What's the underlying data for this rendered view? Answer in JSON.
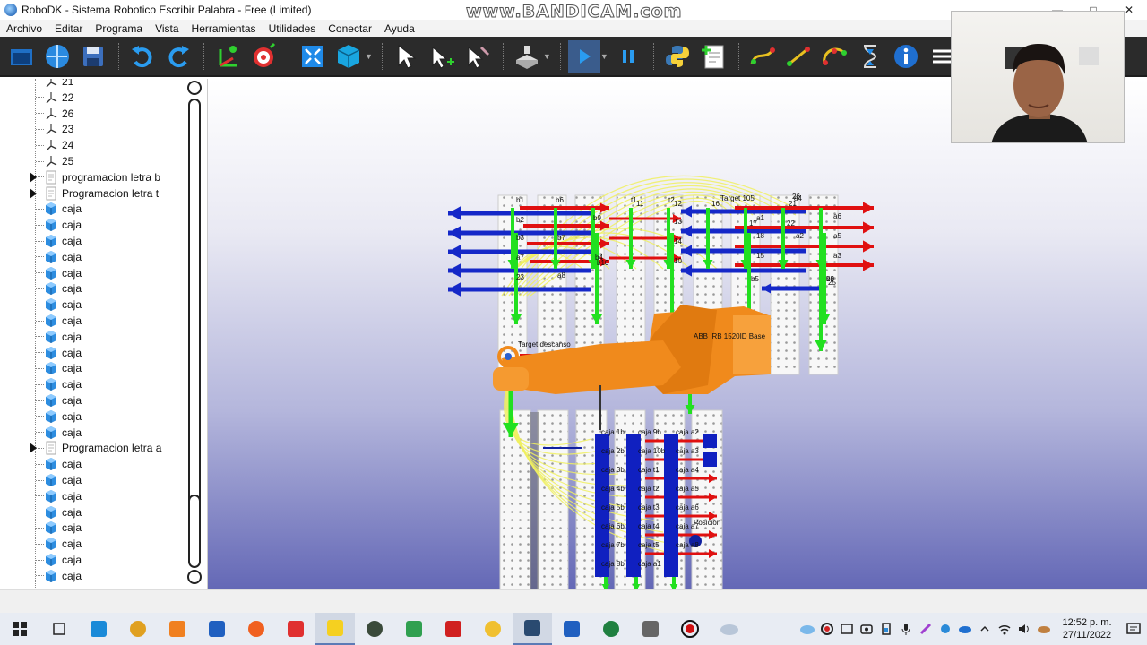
{
  "window": {
    "title": "RoboDK - Sistema Robotico Escribir Palabra - Free (Limited)",
    "watermark": "www.BANDICAM.com"
  },
  "menu": [
    "Archivo",
    "Editar",
    "Programa",
    "Vista",
    "Herramientas",
    "Utilidades",
    "Conectar",
    "Ayuda"
  ],
  "toolbar": {
    "icons": [
      "open-station-icon",
      "online-library-icon",
      "save-icon",
      "undo-icon",
      "redo-icon",
      "add-reference-frame-icon",
      "add-target-icon",
      "fit-all-icon",
      "iso-view-icon",
      "select-icon",
      "move-reference-icon",
      "move-tool-icon",
      "collision-icon",
      "run-program-icon",
      "pause-icon",
      "python-icon",
      "add-program-icon",
      "move-joint-icon",
      "move-linear-icon",
      "move-circular-icon",
      "pause-instruction-icon",
      "info-icon",
      "more-icon"
    ]
  },
  "tree": {
    "targets": [
      "21",
      "22",
      "26",
      "23",
      "24",
      "25"
    ],
    "programs_top": [
      "programacion letra b",
      "Programacion letra t"
    ],
    "caja_label": "caja",
    "caja_count_first": 15,
    "program_mid": "Programacion letra a",
    "caja_count_second": 8
  },
  "scene": {
    "top_targets": [
      "b1",
      "b6",
      "t1",
      "t2",
      "Target 105",
      "a4",
      "b2",
      "b9",
      "11",
      "12",
      "16",
      "21",
      "a6",
      "13",
      "a1",
      "17",
      "22",
      "b3",
      "b7",
      "14",
      "18",
      "a2",
      "a5",
      "a7",
      "b4",
      "b10",
      "10",
      "15",
      "a3",
      "23",
      "a8",
      "b5",
      "b8",
      "20",
      "25",
      "26"
    ],
    "robot_label": "ABB IRB 1520ID Base",
    "home_label": "Target descanso",
    "box_labels_col1": [
      "caja 1b",
      "caja 2b",
      "caja 3b",
      "caja 4b",
      "caja 5b",
      "caja 6b",
      "caja 7b",
      "caja 8b"
    ],
    "box_labels_col2": [
      "caja 9b",
      "caja 10b",
      "caja t1",
      "caja t2",
      "caja t3",
      "caja t4",
      "caja t5",
      "caja a1"
    ],
    "box_labels_col3": [
      "caja a2",
      "caja a3",
      "caja a4",
      "caja a5",
      "caja a6",
      "caja a7",
      "caja a8"
    ],
    "posicion_label": "Posición"
  },
  "taskbar": {
    "apps": [
      "windows-start-icon",
      "task-view-icon",
      "edge-icon",
      "chrome-icon",
      "sublime-icon",
      "remote-desktop-icon",
      "firefox-icon",
      "anydesk-icon",
      "sticky-notes-icon",
      "mathworks-icon",
      "network-tool-icon",
      "acrobat-icon",
      "file-explorer-icon",
      "robodk-icon",
      "word-icon",
      "excel-icon",
      "vmware-icon",
      "bandicam-icon"
    ],
    "time": "12:52 p. m.",
    "date": "27/11/2022"
  },
  "colors": {
    "toolbar_bg": "#2b2b2b",
    "robot": "#f08a1c",
    "x_axis": "#e01010",
    "y_axis": "#1528c8",
    "z_axis": "#22e020",
    "box": "#1020c0"
  }
}
